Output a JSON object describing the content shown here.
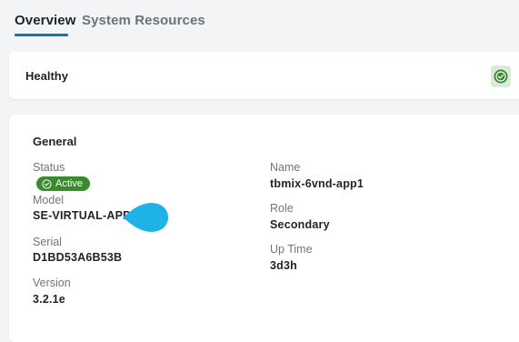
{
  "tabs": [
    {
      "label": "Overview",
      "active": true
    },
    {
      "label": "System Resources",
      "active": false
    }
  ],
  "health": {
    "title": "Healthy",
    "status_icon": "check-circle-icon",
    "status_color": "#3a8a2e"
  },
  "general": {
    "title": "General",
    "fields": {
      "status": {
        "label": "Status",
        "value": "Active",
        "icon": "check-circle-icon",
        "color": "#3a8a2e"
      },
      "model": {
        "label": "Model",
        "value": "SE-VIRTUAL-APP"
      },
      "serial": {
        "label": "Serial",
        "value": "D1BD53A6B53B"
      },
      "version": {
        "label": "Version",
        "value": "3.2.1e"
      },
      "name": {
        "label": "Name",
        "value": "tbmix-6vnd-app1"
      },
      "role": {
        "label": "Role",
        "value": "Secondary"
      },
      "uptime": {
        "label": "Up Time",
        "value": "3d3h"
      }
    }
  },
  "pointer": {
    "color": "#1fb2e6"
  }
}
